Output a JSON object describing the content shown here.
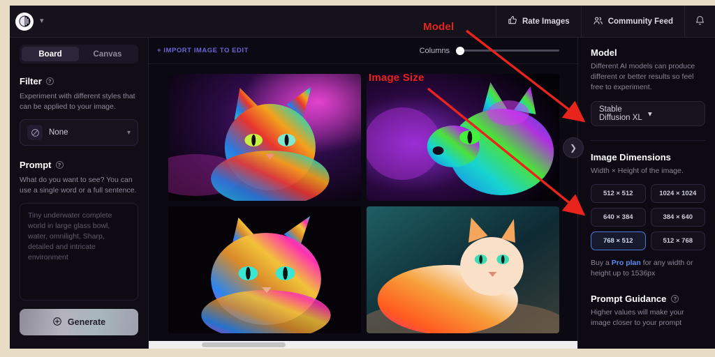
{
  "topbar": {
    "logo_icon": "app-logo-icon",
    "workspace_chevron": "chevron-down-icon",
    "rate_images": "Rate Images",
    "community_feed": "Community Feed",
    "notifications_icon": "bell-icon"
  },
  "sidebar_left": {
    "tabs": [
      {
        "label": "Board",
        "active": true
      },
      {
        "label": "Canvas",
        "active": false
      }
    ],
    "filter": {
      "title": "Filter",
      "help_icon": "question-circle-icon",
      "description": "Experiment with different styles that can be applied to your image.",
      "selected": "None",
      "selected_icon": "no-filter-icon",
      "chevron": "chevron-down-icon"
    },
    "prompt": {
      "title": "Prompt",
      "help_icon": "question-circle-icon",
      "description": "What do you want to see? You can use a single word or a full sentence.",
      "value": "Tiny underwater complete world in large glass bowl, water, omnilight, Sharp, detailed and intricate environment",
      "placeholder": "Tiny underwater complete world in large glass bowl, water, omnilight, Sharp, detailed and intricate environment"
    },
    "generate": {
      "label": "Generate",
      "icon": "plus-circle-icon"
    }
  },
  "main": {
    "import_label": "+ IMPORT IMAGE TO EDIT",
    "columns_label": "Columns",
    "columns_value": 1,
    "next_icon": "chevron-right-icon",
    "thumbnails": [
      {
        "alt": "neon rainbow fluffy cat facing forward"
      },
      {
        "alt": "neon green and purple cat in profile"
      },
      {
        "alt": "neon magenta and gold long-haired cat"
      },
      {
        "alt": "orange and white fluffy cat with rainbow fur"
      }
    ]
  },
  "sidebar_right": {
    "model": {
      "title": "Model",
      "description": "Different AI models can produce different or better results so feel free to experiment.",
      "selected": "Stable Diffusion XL",
      "chevron": "chevron-down-icon"
    },
    "dimensions": {
      "title": "Image Dimensions",
      "description": "Width × Height of the image.",
      "options": [
        {
          "label": "512 × 512",
          "selected": false
        },
        {
          "label": "1024 × 1024",
          "selected": false
        },
        {
          "label": "640 × 384",
          "selected": false
        },
        {
          "label": "384 × 640",
          "selected": false
        },
        {
          "label": "768 × 512",
          "selected": true
        },
        {
          "label": "512 × 768",
          "selected": false
        }
      ],
      "upsell_prefix": "Buy a ",
      "upsell_link": "Pro plan",
      "upsell_suffix": " for any width or height up to 1536px"
    },
    "prompt_guidance": {
      "title": "Prompt Guidance",
      "help_icon": "question-circle-icon",
      "description": "Higher values will make your image closer to your prompt"
    }
  },
  "annotations": [
    {
      "text": "Model",
      "color": "#e8241c"
    },
    {
      "text": "Image Size",
      "color": "#e8241c"
    }
  ],
  "colors": {
    "page_background": "#e9dcc6",
    "app_background": "#0d0b13",
    "panel": "#100d17",
    "accent_link": "#6e63d6",
    "accent_pro": "#5b8cf0",
    "selected_border": "#4f7ad6",
    "annotation": "#e8241c"
  }
}
